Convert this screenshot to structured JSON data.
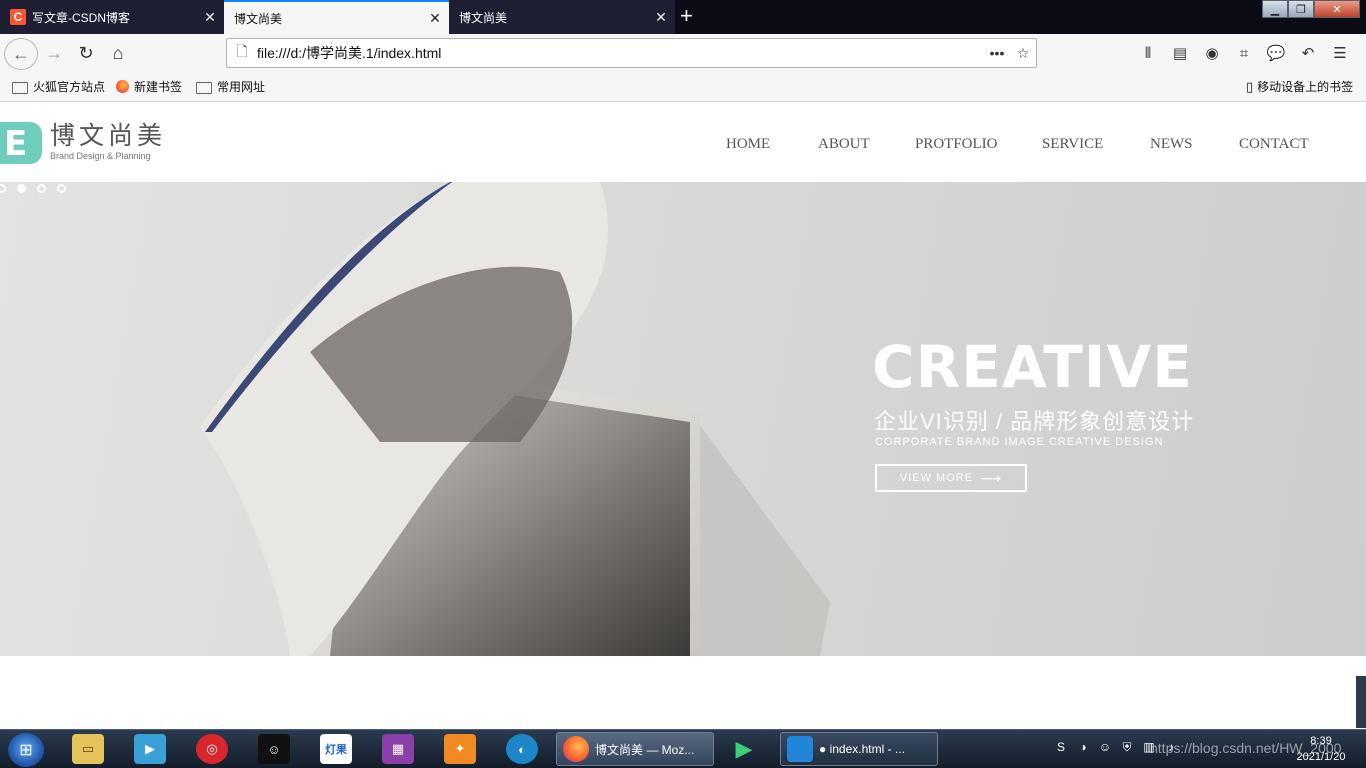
{
  "browser": {
    "tabs": [
      {
        "label": "写文章-CSDN博客",
        "favicon": "C",
        "active": false
      },
      {
        "label": "博文尚美",
        "active": true
      },
      {
        "label": "博文尚美",
        "active": false
      }
    ],
    "url": "file:///d:/博学尚美.1/index.html",
    "bookmarks": [
      "火狐官方站点",
      "新建书签",
      "常用网址"
    ],
    "mobile_bookmarks": "移动设备上的书签"
  },
  "site": {
    "logo": {
      "letter": "E",
      "name": "博文尚美",
      "tagline": "Brand Design & Planning",
      "color": "#6fcdbc"
    },
    "nav": [
      "HOME",
      "ABOUT",
      "PROTFOLIO",
      "SERVICE",
      "NEWS",
      "CONTACT"
    ],
    "banner": {
      "title": "CREATIVE",
      "subtitle_cn": "企业VI识别 / 品牌形象创意设计",
      "subtitle_en": "CORPORATE BRAND IMAGE CREATIVE DESIGN",
      "button": "VIEW MORE",
      "slides": 4,
      "active_slide": 2
    }
  },
  "taskbar": {
    "tasks": [
      {
        "label": "博文尚美 — Moz..."
      },
      {
        "label": "● index.html - ..."
      }
    ],
    "apps": [
      "灯果"
    ],
    "clock": {
      "time": "8:39",
      "date": "2021/1/20"
    },
    "watermark": "https://blog.csdn.net/HW_2000"
  }
}
